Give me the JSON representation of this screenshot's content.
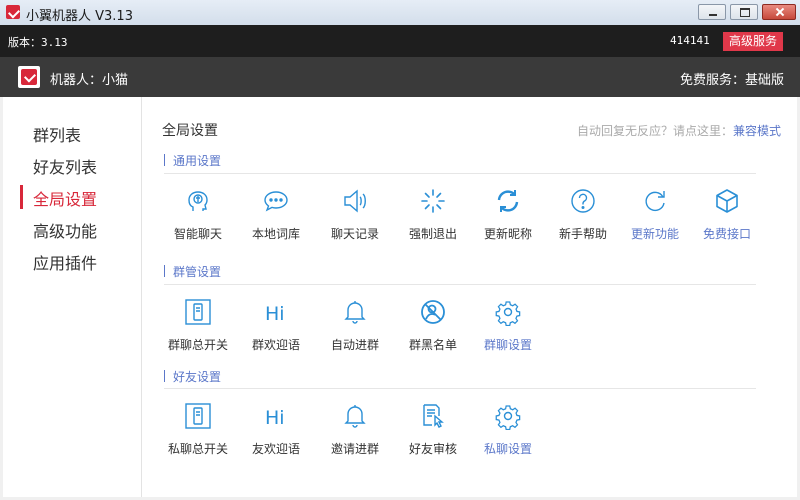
{
  "window": {
    "title": "小翼机器人 V3.13"
  },
  "topbar": {
    "version": "版本：3.13",
    "user_id": "414141",
    "premium_label": "高级服务"
  },
  "robotbar": {
    "robot_name": "机器人：小猫",
    "free_service": "免费服务：基础版"
  },
  "sidebar": {
    "items": [
      {
        "label": "群列表"
      },
      {
        "label": "好友列表"
      },
      {
        "label": "全局设置",
        "active": true
      },
      {
        "label": "高级功能"
      },
      {
        "label": "应用插件"
      }
    ]
  },
  "main": {
    "title": "全局设置",
    "hint_text": "自动回复无反应？请点这里：",
    "hint_link": "兼容模式",
    "sections": [
      {
        "heading": "通用设置",
        "tiles": [
          {
            "label": "智能聊天",
            "icon": "brain-head-icon"
          },
          {
            "label": "本地词库",
            "icon": "chat-bubble-icon"
          },
          {
            "label": "聊天记录",
            "icon": "speaker-icon"
          },
          {
            "label": "强制退出",
            "icon": "loading-spinner-icon"
          },
          {
            "label": "更新昵称",
            "icon": "refresh-arrows-icon"
          },
          {
            "label": "新手帮助",
            "icon": "help-circle-icon"
          },
          {
            "label": "更新功能",
            "icon": "reload-icon"
          },
          {
            "label": "免费接口",
            "icon": "cube-icon"
          }
        ]
      },
      {
        "heading": "群管设置",
        "tiles": [
          {
            "label": "群聊总开关",
            "icon": "switch-icon"
          },
          {
            "label": "群欢迎语",
            "icon": "hi-icon"
          },
          {
            "label": "自动进群",
            "icon": "bell-icon"
          },
          {
            "label": "群黑名单",
            "icon": "blocked-user-icon"
          },
          {
            "label": "群聊设置",
            "icon": "gear-icon"
          }
        ]
      },
      {
        "heading": "好友设置",
        "tiles": [
          {
            "label": "私聊总开关",
            "icon": "switch-icon"
          },
          {
            "label": "友欢迎语",
            "icon": "hi-icon"
          },
          {
            "label": "邀请进群",
            "icon": "bell-icon"
          },
          {
            "label": "好友审核",
            "icon": "document-click-icon"
          },
          {
            "label": "私聊设置",
            "icon": "gear-icon"
          }
        ]
      }
    ]
  },
  "colors": {
    "accent_red": "#d8283a",
    "link_blue": "#5b77c9",
    "icon_blue": "#2a8fd6"
  }
}
